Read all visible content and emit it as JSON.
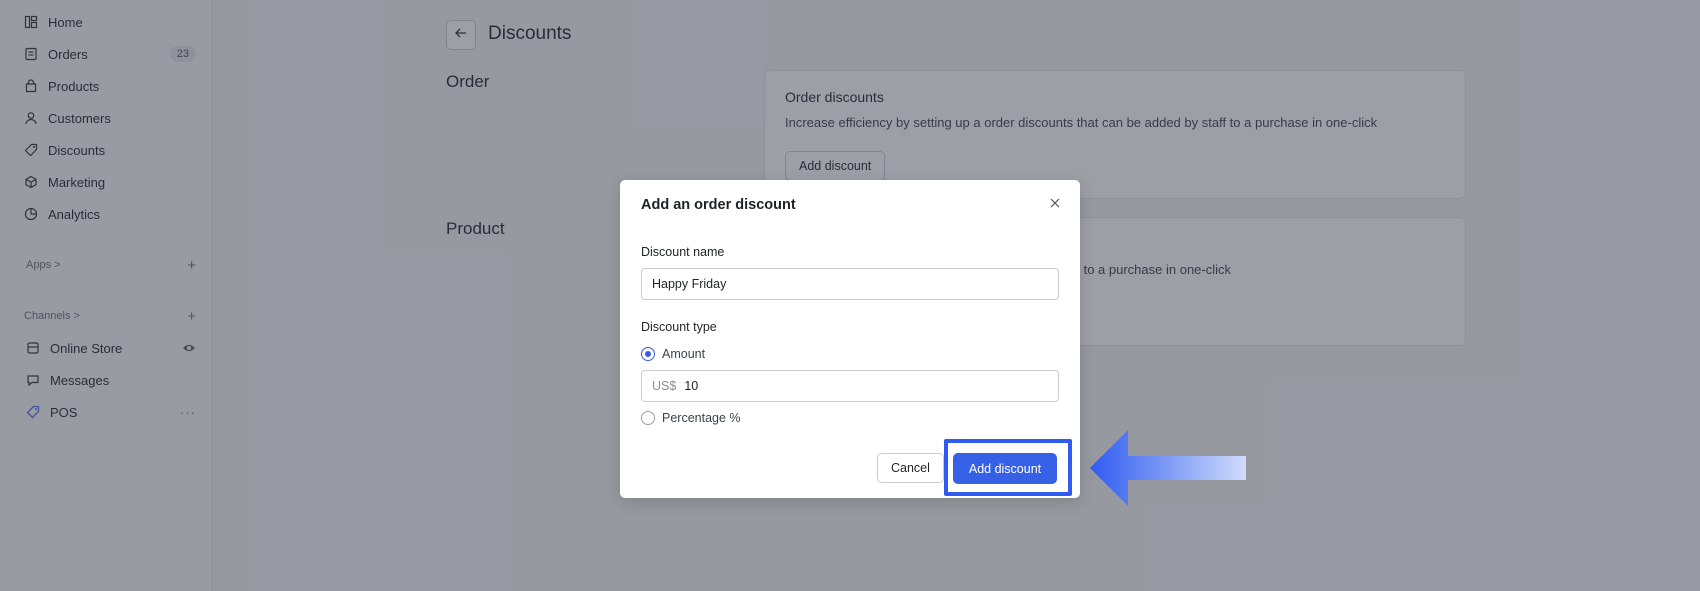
{
  "sidebar": {
    "items": [
      {
        "label": "Home",
        "icon": "home-icon"
      },
      {
        "label": "Orders",
        "icon": "orders-icon",
        "badge": "23"
      },
      {
        "label": "Products",
        "icon": "bag-icon"
      },
      {
        "label": "Customers",
        "icon": "user-icon"
      },
      {
        "label": "Discounts",
        "icon": "tag-icon"
      },
      {
        "label": "Marketing",
        "icon": "cube-icon"
      },
      {
        "label": "Analytics",
        "icon": "chart-icon"
      }
    ],
    "apps_label": "Apps >",
    "channels_label": "Channels >",
    "channels": [
      {
        "label": "Online Store",
        "icon": "store-icon"
      },
      {
        "label": "Messages",
        "icon": "messages-icon"
      },
      {
        "label": "POS",
        "icon": "pos-icon"
      }
    ]
  },
  "main": {
    "title": "Discounts",
    "sections": [
      {
        "title": "Order",
        "card_title": "Order discounts",
        "card_text": "Increase efficiency by setting up a order discounts that can be added by staff to a purchase in one-click",
        "button": "Add discount"
      },
      {
        "title": "Product",
        "card_text_visible": "ff to a purchase in one-click"
      }
    ]
  },
  "modal": {
    "title": "Add an order discount",
    "name_label": "Discount name",
    "name_value": "Happy Friday",
    "type_label": "Discount type",
    "option_amount": "Amount",
    "amount_prefix": "US$",
    "amount_value": "10",
    "option_percentage": "Percentage %",
    "cancel": "Cancel",
    "submit": "Add discount"
  },
  "colors": {
    "primary": "#3661e6",
    "highlight": "#2f5bf0"
  }
}
